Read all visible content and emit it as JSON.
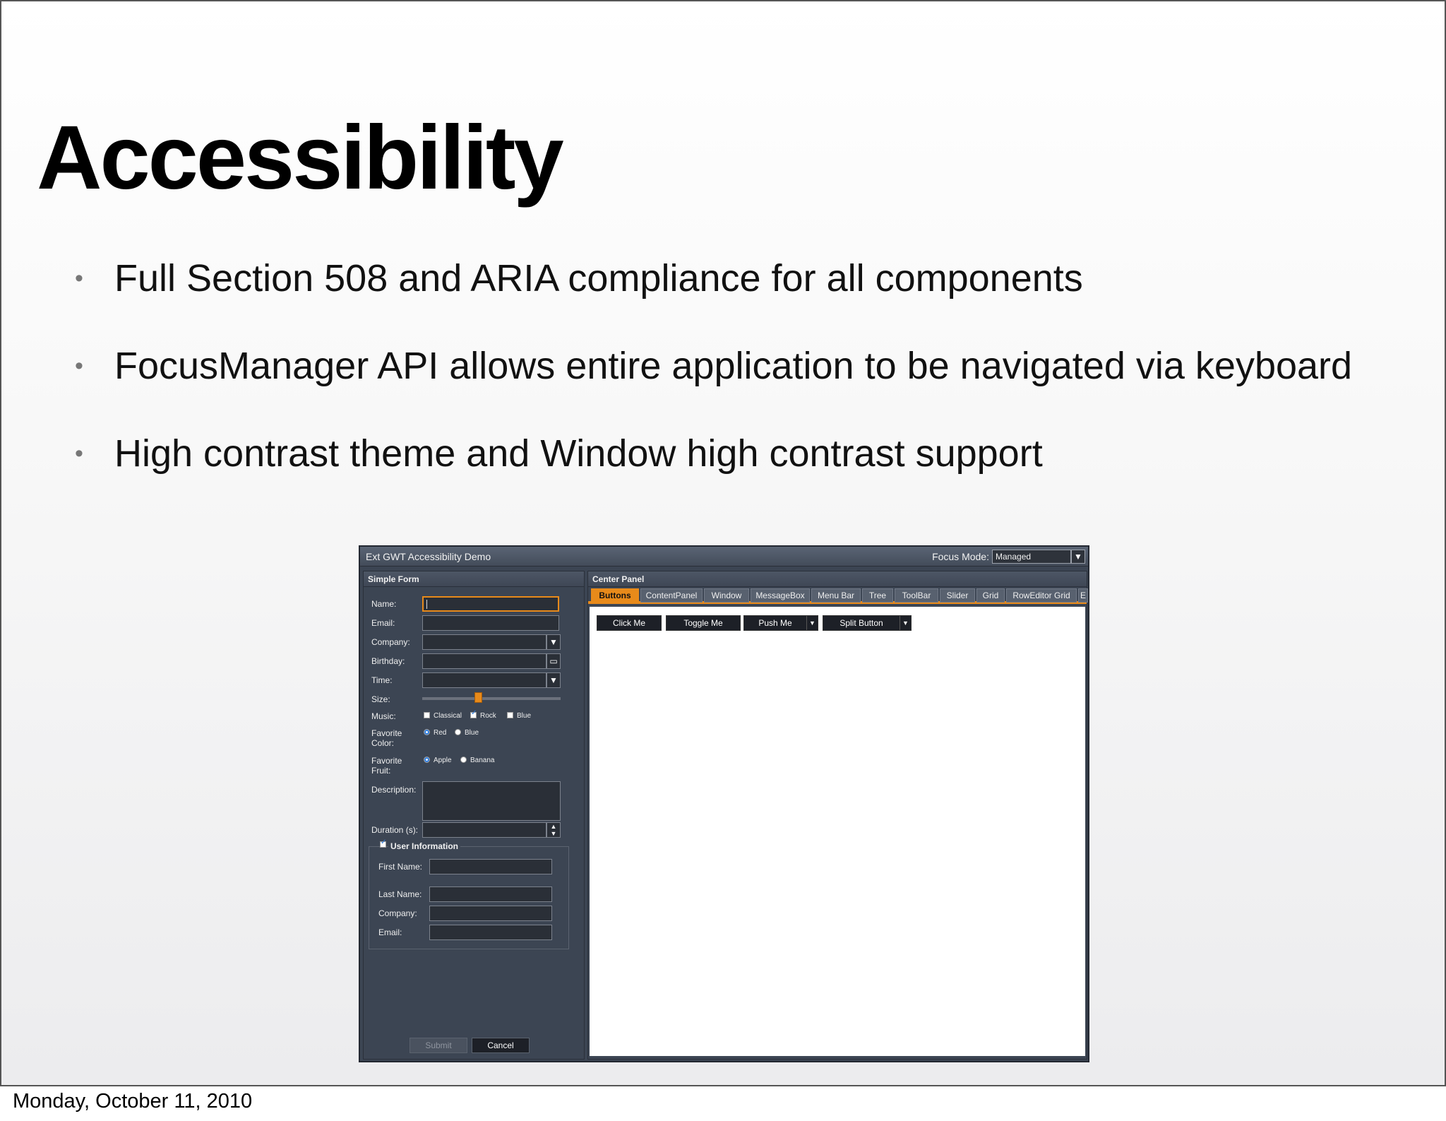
{
  "slide": {
    "title": "Accessibility",
    "bullets": [
      "Full Section 508 and ARIA compliance for all components",
      "FocusManager API allows entire application to be navigated via keyboard",
      "High contrast theme and Window high contrast support"
    ],
    "footer_date": "Monday, October 11, 2010"
  },
  "app": {
    "title": "Ext GWT Accessibility Demo",
    "focus_mode_label": "Focus Mode:",
    "focus_mode_value": "Managed",
    "form": {
      "title": "Simple Form",
      "labels": {
        "name": "Name:",
        "email": "Email:",
        "company": "Company:",
        "birthday": "Birthday:",
        "time": "Time:",
        "size": "Size:",
        "music": "Music:",
        "favorite_color": "Favorite Color:",
        "favorite_fruit": "Favorite Fruit:",
        "description": "Description:",
        "duration": "Duration (s):"
      },
      "music_options": [
        "Classical",
        "Rock",
        "Blue"
      ],
      "color_options": [
        "Red",
        "Blue"
      ],
      "fruit_options": [
        "Apple",
        "Banana"
      ],
      "size_value_fraction": 0.4,
      "user_info": {
        "legend": "User Information",
        "labels": {
          "first_name": "First Name:",
          "last_name": "Last Name:",
          "company": "Company:",
          "email": "Email:"
        }
      },
      "submit_label": "Submit",
      "cancel_label": "Cancel"
    },
    "center": {
      "title": "Center Panel",
      "tabs": [
        "Buttons",
        "ContentPanel",
        "Window",
        "MessageBox",
        "Menu Bar",
        "Tree",
        "ToolBar",
        "Slider",
        "Grid",
        "RowEditor Grid",
        "E"
      ],
      "buttons": [
        "Click Me",
        "Toggle Me",
        "Push Me",
        "Split Button"
      ]
    },
    "colors": {
      "accent": "#e88a1a",
      "panel": "#3c4553",
      "button": "#1d2027"
    }
  }
}
